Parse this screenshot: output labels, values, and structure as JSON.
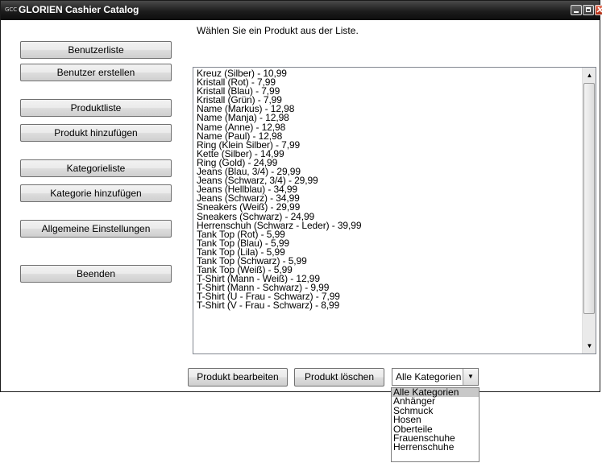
{
  "window": {
    "icon_text": "GCC",
    "title": "GLORIEN Cashier Catalog",
    "controls": [
      "minimize-icon",
      "maximize-icon",
      "close-icon"
    ]
  },
  "sidebar": {
    "buttons": [
      {
        "label": "Benutzerliste"
      },
      {
        "label": "Benutzer erstellen"
      },
      {
        "label": "Produktliste"
      },
      {
        "label": "Produkt hinzufügen"
      },
      {
        "label": "Kategorieliste"
      },
      {
        "label": "Kategorie hinzufügen"
      },
      {
        "label": "Allgemeine Einstellungen"
      },
      {
        "label": "Beenden"
      }
    ]
  },
  "main": {
    "instruction": "Wählen Sie ein Produkt aus der Liste.",
    "products": [
      "Kreuz (Silber) - 10,99",
      "Kristall (Rot) - 7,99",
      "Kristall (Blau) - 7,99",
      "Kristall (Grün) - 7,99",
      "Name (Markus) - 12,98",
      "Name (Manja) - 12,98",
      "Name (Anne) - 12,98",
      "Name (Paul) - 12,98",
      "Ring (Klein Silber) - 7,99",
      "Kette (Silber) - 14,99",
      "Ring (Gold) - 24,99",
      "Jeans (Blau, 3/4) - 29,99",
      "Jeans (Schwarz, 3/4) - 29,99",
      "Jeans (Hellblau) - 34,99",
      "Jeans (Schwarz) - 34,99",
      "Sneakers (Weiß) - 29,99",
      "Sneakers (Schwarz) - 24,99",
      "Herrenschuh (Schwarz - Leder) - 39,99",
      "Tank Top (Rot) - 5,99",
      "Tank Top (Blau) - 5,99",
      "Tank Top (Lila) - 5,99",
      "Tank Top (Schwarz) - 5,99",
      "Tank Top (Weiß) - 5,99",
      "T-Shirt (Mann - Weiß) - 12,99",
      "T-Shirt (Mann - Schwarz) - 9,99",
      "T-Shirt (U - Frau - Schwarz) - 7,99",
      "T-Shirt (V - Frau - Schwarz) - 8,99"
    ],
    "edit_button": "Produkt bearbeiten",
    "delete_button": "Produkt löschen",
    "category_select": {
      "selected": "Alle Kategorien",
      "options": [
        "Alle Kategorien",
        "Anhänger",
        "Schmuck",
        "Hosen",
        "Oberteile",
        "Frauenschuhe",
        "Herrenschuhe"
      ]
    }
  }
}
